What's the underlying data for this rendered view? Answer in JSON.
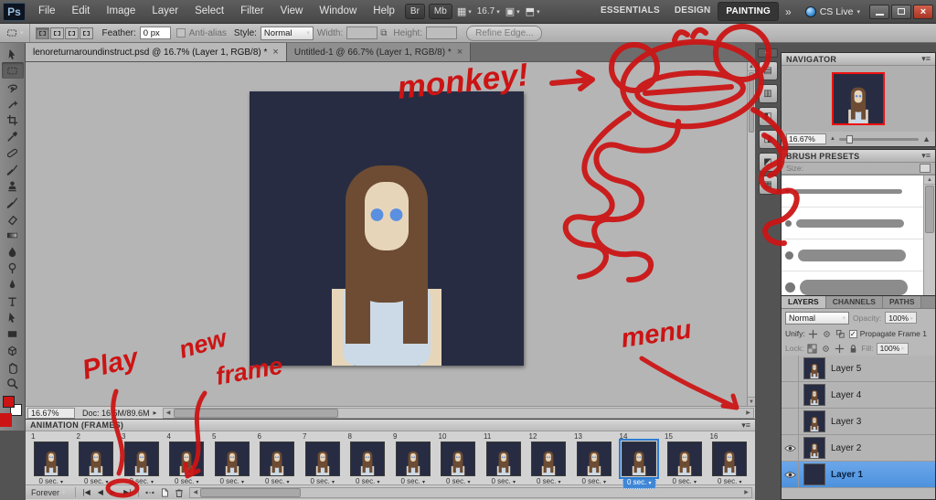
{
  "app": {
    "logo": "Ps"
  },
  "glyphs": {
    "caret_down": "▾",
    "caret_right": "▸",
    "up": "▲",
    "down": "▼",
    "left": "◀",
    "right": "▶",
    "panel_menu": "▾≡",
    "check": "✓",
    "close": "×",
    "collapse": "◂◂",
    "link": "⧉"
  },
  "menubar": {
    "items": [
      "File",
      "Edit",
      "Image",
      "Layer",
      "Select",
      "Filter",
      "View",
      "Window",
      "Help"
    ],
    "bridge": "Br",
    "minibridge": "Mb",
    "zoom": "16.7",
    "workspaces": [
      {
        "label": "ESSENTIALS"
      },
      {
        "label": "DESIGN"
      },
      {
        "label": "PAINTING",
        "active": true
      }
    ],
    "overflow": "»",
    "cslive": "CS Live"
  },
  "options": {
    "feather_label": "Feather:",
    "feather_value": "0 px",
    "antialias": "Anti-alias",
    "style_label": "Style:",
    "style_value": "Normal",
    "width_label": "Width:",
    "height_label": "Height:",
    "refine": "Refine Edge..."
  },
  "doc_tabs": [
    {
      "title": "lenoreturnaroundinstruct.psd @ 16.7% (Layer 1, RGB/8) *",
      "close": "×",
      "active": true
    },
    {
      "title": "Untitled-1 @ 66.7% (Layer 1, RGB/8) *",
      "close": "×"
    }
  ],
  "tools": [
    {
      "name": "move-tool",
      "icon": "#i-arrow"
    },
    {
      "name": "rectangular-marquee-tool",
      "icon": "#i-dashbox",
      "selected": true
    },
    {
      "name": "lasso-tool",
      "icon": "#i-loop"
    },
    {
      "name": "quick-selection-tool",
      "icon": "#i-wand"
    },
    {
      "name": "crop-tool",
      "icon": "#i-crop"
    },
    {
      "name": "eyedropper-tool",
      "icon": "#i-dropper"
    },
    {
      "name": "spot-healing-brush-tool",
      "icon": "#i-bandaid"
    },
    {
      "name": "brush-tool",
      "icon": "#i-brush"
    },
    {
      "name": "clone-stamp-tool",
      "icon": "#i-stamp"
    },
    {
      "name": "history-brush-tool",
      "icon": "#i-brush"
    },
    {
      "name": "eraser-tool",
      "icon": "#i-eraser"
    },
    {
      "name": "gradient-tool",
      "icon": "#i-grad"
    },
    {
      "name": "blur-tool",
      "icon": "#i-drop"
    },
    {
      "name": "dodge-tool",
      "icon": "#i-dodge"
    },
    {
      "name": "pen-tool",
      "icon": "#i-pen"
    },
    {
      "name": "horizontal-type-tool",
      "icon": "#i-type"
    },
    {
      "name": "path-selection-tool",
      "icon": "#i-arrow"
    },
    {
      "name": "rectangle-tool",
      "icon": "#i-rect"
    },
    {
      "name": "3d-rotate-tool",
      "icon": "#i-cube"
    },
    {
      "name": "hand-tool",
      "icon": "#i-hand"
    },
    {
      "name": "zoom-tool",
      "icon": "#i-zoom"
    }
  ],
  "status": {
    "zoom": "16.67%",
    "doc": "Doc: 16.5M/89.6M"
  },
  "animation": {
    "title": "ANIMATION (FRAMES)",
    "loop": "Forever",
    "transport": {
      "first": "|◀",
      "prev": "◀",
      "play": "▶",
      "next": "▶|"
    },
    "frames": [
      {
        "number": "1",
        "delay": "0 sec."
      },
      {
        "number": "2",
        "delay": "0 sec."
      },
      {
        "number": "3",
        "delay": "0 sec."
      },
      {
        "number": "4",
        "delay": "0 sec."
      },
      {
        "number": "5",
        "delay": "0 sec."
      },
      {
        "number": "6",
        "delay": "0 sec."
      },
      {
        "number": "7",
        "delay": "0 sec."
      },
      {
        "number": "8",
        "delay": "0 sec."
      },
      {
        "number": "9",
        "delay": "0 sec."
      },
      {
        "number": "10",
        "delay": "0 sec."
      },
      {
        "number": "11",
        "delay": "0 sec."
      },
      {
        "number": "12",
        "delay": "0 sec."
      },
      {
        "number": "13",
        "delay": "0 sec."
      },
      {
        "number": "14",
        "delay": "0 sec.",
        "selected": true
      },
      {
        "number": "15",
        "delay": "0 sec."
      },
      {
        "number": "16",
        "delay": "0 sec."
      }
    ]
  },
  "navigator": {
    "title": "NAVIGATOR",
    "zoom": "16.67%"
  },
  "brushes": {
    "title": "BRUSH PRESETS",
    "size_label": "Size:"
  },
  "layers_panel": {
    "tabs": [
      {
        "label": "LAYERS",
        "active": true
      },
      {
        "label": "CHANNELS"
      },
      {
        "label": "PATHS"
      }
    ],
    "blend": "Normal",
    "opacity_label": "Opacity:",
    "opacity": "100%",
    "unify_label": "Unify:",
    "propagate": "Propagate Frame 1",
    "lock_label": "Lock:",
    "fill_label": "Fill:",
    "fill": "100%",
    "layers": [
      {
        "name": "Layer 5",
        "girl": true
      },
      {
        "name": "Layer 4",
        "girl": true
      },
      {
        "name": "Layer 3",
        "girl": true
      },
      {
        "name": "Layer 2",
        "girl": true,
        "visible": true
      },
      {
        "name": "Layer 1",
        "navy": true,
        "visible": true,
        "selected": true
      }
    ]
  },
  "annotations": {
    "monkey": "monkey!",
    "play": "Play",
    "new_word": "new",
    "frame_word": "frame",
    "menu": "menu",
    "ink_color": "#cc1414"
  },
  "colors": {
    "selection_blue": "#2b7cd3",
    "foreground_red": "#cc1414",
    "canvas_navy": "#272c42"
  }
}
